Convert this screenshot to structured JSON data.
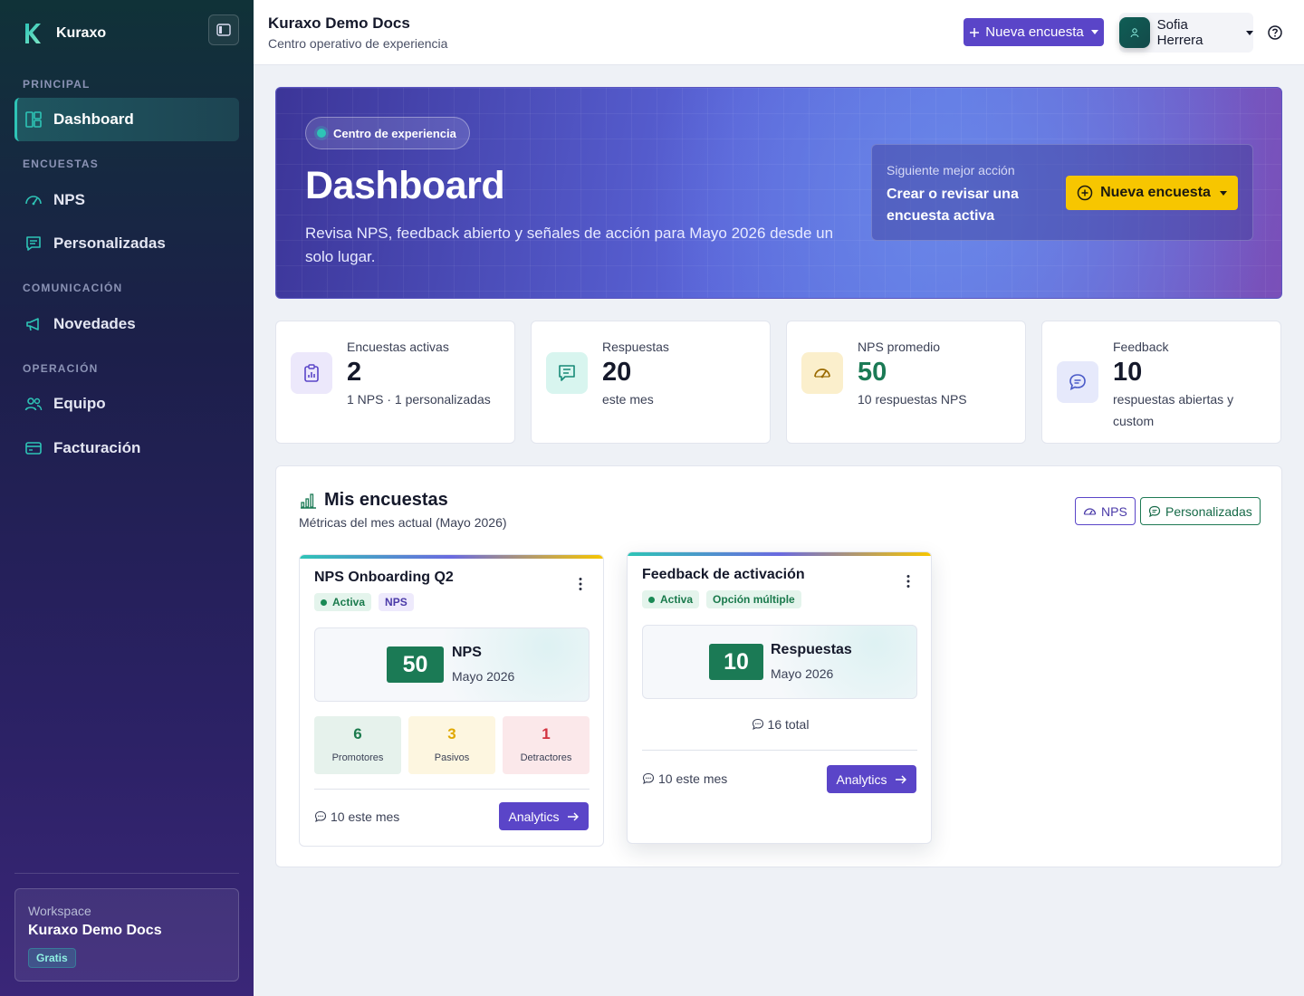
{
  "sidebar": {
    "brand": "Kuraxo",
    "sections": {
      "principal": "PRINCIPAL",
      "encuestas": "ENCUESTAS",
      "comunicacion": "COMUNICACIÓN",
      "operacion": "OPERACIÓN"
    },
    "items": {
      "dashboard": "Dashboard",
      "nps": "NPS",
      "personalizadas": "Personalizadas",
      "novedades": "Novedades",
      "equipo": "Equipo",
      "facturacion": "Facturación"
    },
    "workspace": {
      "label": "Workspace",
      "name": "Kuraxo Demo Docs",
      "plan": "Gratis"
    }
  },
  "header": {
    "title": "Kuraxo Demo Docs",
    "subtitle": "Centro operativo de experiencia",
    "new_survey": "Nueva encuesta",
    "user": "Sofia Herrera"
  },
  "hero": {
    "pill": "Centro de experiencia",
    "title": "Dashboard",
    "description": "Revisa NPS, feedback abierto y señales de acción para Mayo 2026 desde un solo lugar.",
    "next_label": "Siguiente mejor acción",
    "next_text": "Crear o revisar una encuesta activa",
    "next_button": "Nueva encuesta"
  },
  "stats": [
    {
      "label": "Encuestas activas",
      "value": "2",
      "sub": "1 NPS · 1 personalizadas"
    },
    {
      "label": "Respuestas",
      "value": "20",
      "sub": "este mes"
    },
    {
      "label": "NPS promedio",
      "value": "50",
      "sub": "10 respuestas NPS"
    },
    {
      "label": "Feedback",
      "value": "10",
      "sub": "respuestas abiertas y custom"
    }
  ],
  "panel": {
    "title": "Mis encuestas",
    "subtitle": "Métricas del mes actual (Mayo 2026)",
    "filter_nps": "NPS",
    "filter_custom": "Personalizadas"
  },
  "surveys": [
    {
      "title": "NPS Onboarding Q2",
      "status": "Activa",
      "type": "NPS",
      "metric_value": "50",
      "metric_label": "NPS",
      "period": "Mayo 2026",
      "promotores": "6",
      "promotores_label": "Promotores",
      "pasivos": "3",
      "pasivos_label": "Pasivos",
      "detractores": "1",
      "detractores_label": "Detractores",
      "month_count": "10 este mes",
      "button": "Analytics"
    },
    {
      "title": "Feedback de activación",
      "status": "Activa",
      "type": "Opción múltiple",
      "metric_value": "10",
      "metric_label": "Respuestas",
      "period": "Mayo 2026",
      "total": "16 total",
      "month_count": "10 este mes",
      "button": "Analytics"
    }
  ],
  "colors": {
    "accent": "#5a45c8",
    "teal": "#2ec4b6",
    "yellow": "#f7c600",
    "green": "#1b7a55"
  }
}
